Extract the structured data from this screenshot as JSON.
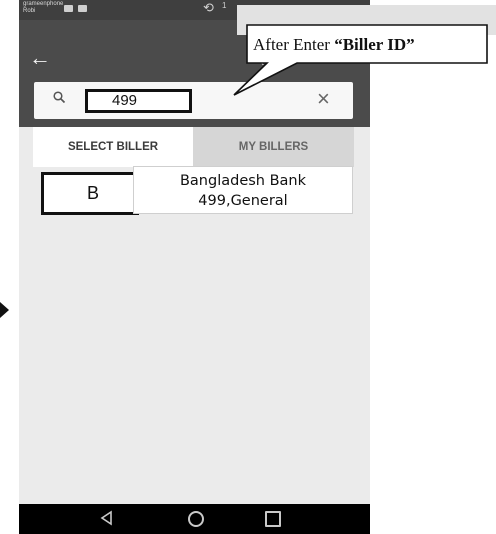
{
  "status_bar": {
    "carrier_line1": "grameenphone",
    "carrier_line2": "Robi",
    "indicator": "1"
  },
  "header": {
    "back_icon": "arrow-left-icon",
    "title_partial": "("
  },
  "search": {
    "value": "499",
    "search_icon": "search-icon",
    "clear_icon": "close-icon"
  },
  "tabs": [
    {
      "label": "SELECT BILLER",
      "active": true
    },
    {
      "label": "MY BILLERS",
      "active": false
    }
  ],
  "result": {
    "letter": "B",
    "name": "Bangladesh Bank",
    "detail": "499,General"
  },
  "callout": {
    "prefix": "After Enter ",
    "emphasis": "“Biller ID”"
  },
  "nav": {
    "back_icon": "triangle-back-icon",
    "home_icon": "circle-home-icon",
    "recent_icon": "square-recent-icon"
  },
  "colors": {
    "header": "#4b4b4b",
    "body": "#ebebeb",
    "nav": "#000000"
  }
}
